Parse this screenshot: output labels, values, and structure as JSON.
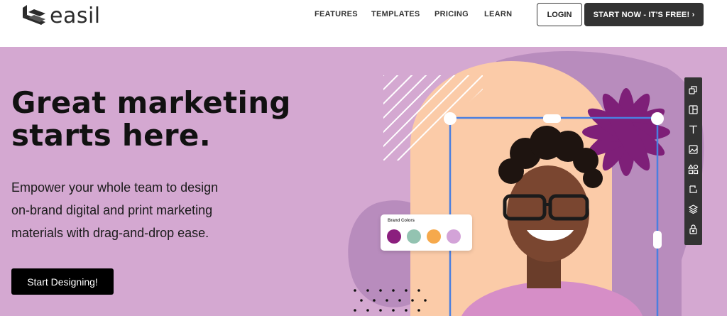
{
  "brand": {
    "name": "easil"
  },
  "nav": {
    "items": [
      {
        "label": "FEATURES"
      },
      {
        "label": "TEMPLATES"
      },
      {
        "label": "PRICING"
      },
      {
        "label": "LEARN"
      }
    ],
    "login_label": "LOGIN",
    "start_label": "START NOW - IT'S FREE! ›"
  },
  "hero": {
    "title_line1": "Great marketing",
    "title_line2": "starts here.",
    "subtitle_line1": "Empower your whole team to design",
    "subtitle_line2": "on-brand digital and print marketing",
    "subtitle_line3": "materials with drag-and-drop ease.",
    "cta_label": "Start Designing!"
  },
  "brand_colors": {
    "title": "Brand Colors",
    "swatches": [
      "#8b1f7e",
      "#93c3b1",
      "#f6a94c",
      "#d3a3d8"
    ]
  },
  "toolbar": {
    "tools": [
      "resize-icon",
      "layout-icon",
      "text-icon",
      "image-icon",
      "shapes-icon",
      "flip-icon",
      "layers-icon",
      "lock-icon"
    ]
  },
  "colors": {
    "hero_bg": "#d4a8d1",
    "accent_purple": "#7e1f78",
    "peach": "#fbcba8",
    "selection_blue": "#4a7fe0",
    "dark_button": "#333333"
  }
}
